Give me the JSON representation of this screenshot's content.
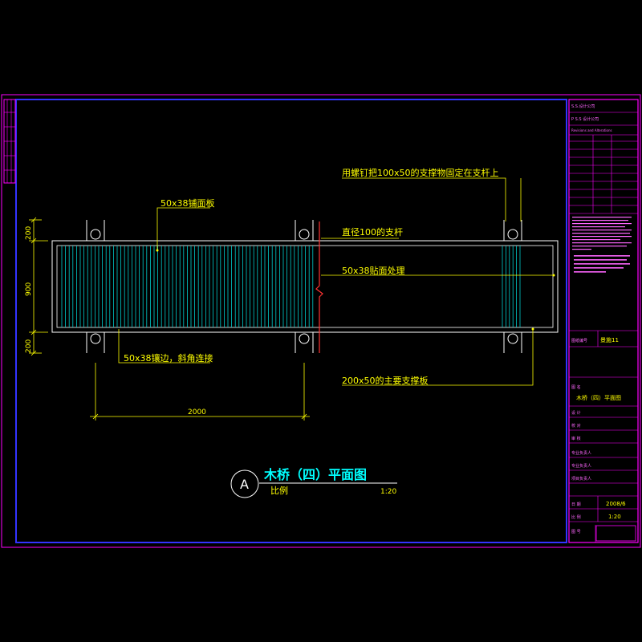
{
  "colors": {
    "background": "#000000",
    "frame": "#ff00ff",
    "inner_frame": "#3333ff",
    "outline": "#ffffff",
    "planks": "#00cccc",
    "annotation": "#ffff00",
    "section_line": "#ff3333"
  },
  "annotations": {
    "deck_board": "50x38铺面板",
    "nail_bolt": "用螺钉把100x50的支撑物固定在支杆上",
    "post": "直径100的支杆",
    "surface_treatment": "50x38贴面处理",
    "edge_strip": "50x38镶边，斜角连接",
    "main_beam": "200x50的主要支撑板"
  },
  "dimensions": {
    "top": "200",
    "middle": "900",
    "bottom": "200",
    "span": "2000"
  },
  "title_block": {
    "symbol": "A",
    "title": "木桥（四）平面图",
    "scale_label": "比例",
    "scale_value": "1:20"
  },
  "side_panel": {
    "header_1": "S.S.设计公司",
    "header_2": "P S.S 设计公司",
    "revisions": "Revisions and Alterations",
    "field_drawing_no": "图纸编号",
    "value_drawing_no": "景施11",
    "field_title": "图 名",
    "value_title": "木桥（四）平面图",
    "field_design": "设 计",
    "field_check": "校 对",
    "field_review": "审 核",
    "field_leader_1": "专业负责人",
    "field_leader_2": "专业负责人",
    "field_project_leader": "项目负责人",
    "field_date": "日 期",
    "value_date": "2008/6",
    "field_scale": "比 例",
    "value_scale": "1:20",
    "field_sheet": "图 号"
  }
}
